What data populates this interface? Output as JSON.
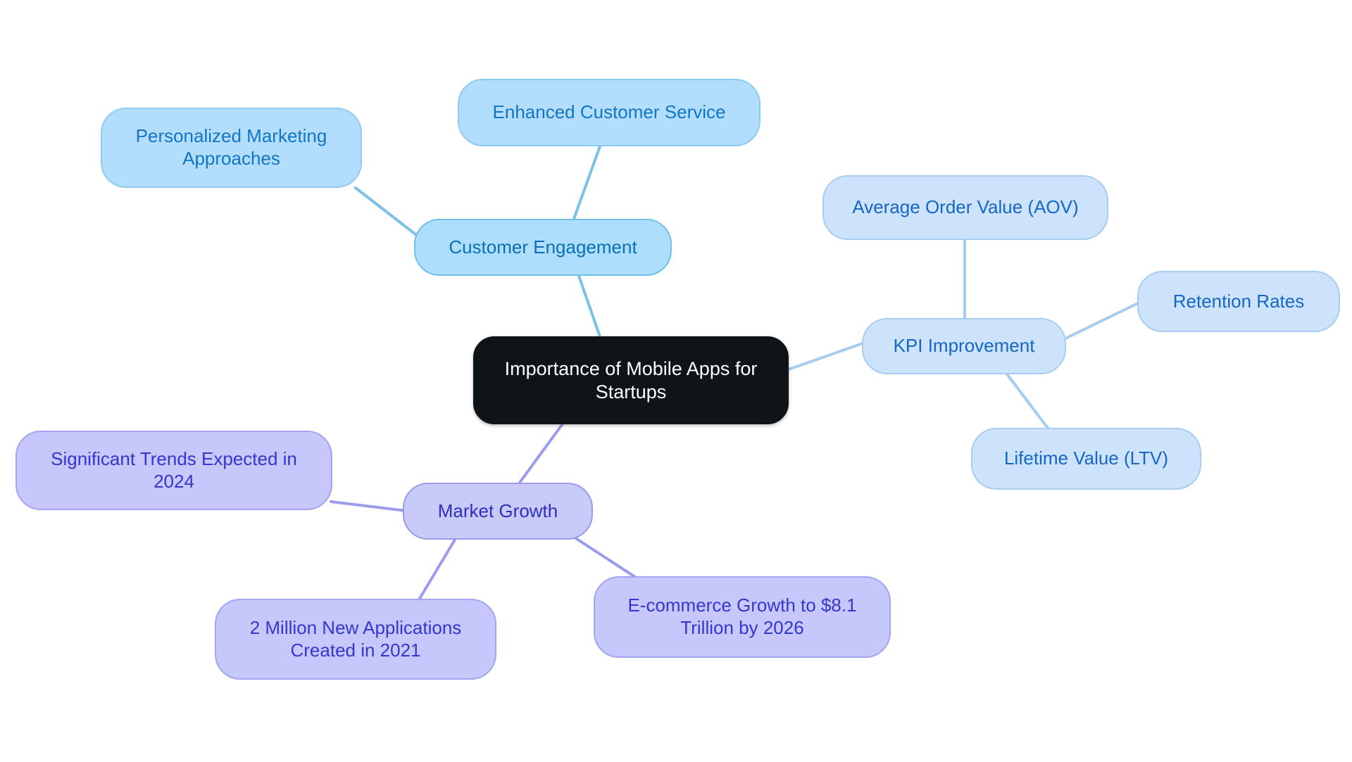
{
  "diagram": {
    "type": "mindmap",
    "title": "Importance of Mobile Apps for Startups",
    "background_color": "#ffffff",
    "root": {
      "id": "root",
      "label": "Importance of Mobile Apps for\nStartups",
      "fill": "#0f1419",
      "text_color": "#ffffff"
    },
    "branches": [
      {
        "id": "customer-engagement",
        "label": "Customer Engagement",
        "fill": "#addffd",
        "border": "#6ec0ea",
        "text_color": "#0a6fb4",
        "edge_color": "#7cc1e8",
        "children": [
          {
            "id": "enhanced-customer-service",
            "label": "Enhanced Customer Service",
            "fill": "#b3ddfc",
            "border": "#8ecbf2",
            "text_color": "#1176c4"
          },
          {
            "id": "personalized-marketing-approaches",
            "label": "Personalized Marketing\nApproaches",
            "fill": "#b3ddfc",
            "border": "#8ecbf2",
            "text_color": "#1176c4"
          }
        ]
      },
      {
        "id": "kpi-improvement",
        "label": "KPI Improvement",
        "fill": "#cce3fb",
        "border": "#a8cdf0",
        "text_color": "#1667c4",
        "edge_color": "#a6cdf0",
        "children": [
          {
            "id": "average-order-value",
            "label": "Average Order Value (AOV)",
            "fill": "#cce3fb",
            "border": "#a8cdf0",
            "text_color": "#1667c4"
          },
          {
            "id": "retention-rates",
            "label": "Retention Rates",
            "fill": "#cce3fb",
            "border": "#a8cdf0",
            "text_color": "#1667c4"
          },
          {
            "id": "lifetime-value",
            "label": "Lifetime Value (LTV)",
            "fill": "#cce3fb",
            "border": "#a8cdf0",
            "text_color": "#1667c4"
          }
        ]
      },
      {
        "id": "market-growth",
        "label": "Market Growth",
        "fill": "#c8caf8",
        "border": "#9a9bec",
        "text_color": "#2f2fbe",
        "edge_color": "#9b9cee",
        "children": [
          {
            "id": "significant-trends-2024",
            "label": "Significant Trends Expected in\n2024",
            "fill": "#c6c7fb",
            "border": "#a3a5f2",
            "text_color": "#3636cf"
          },
          {
            "id": "two-million-new-applications",
            "label": "2 Million New Applications\nCreated in 2021",
            "fill": "#c6c7fb",
            "border": "#a3a5f2",
            "text_color": "#3636cf"
          },
          {
            "id": "ecommerce-growth-2026",
            "label": "E-commerce Growth to $8.1\nTrillion by 2026",
            "fill": "#c6c7fb",
            "border": "#a3a5f2",
            "text_color": "#3636cf"
          }
        ]
      }
    ]
  }
}
